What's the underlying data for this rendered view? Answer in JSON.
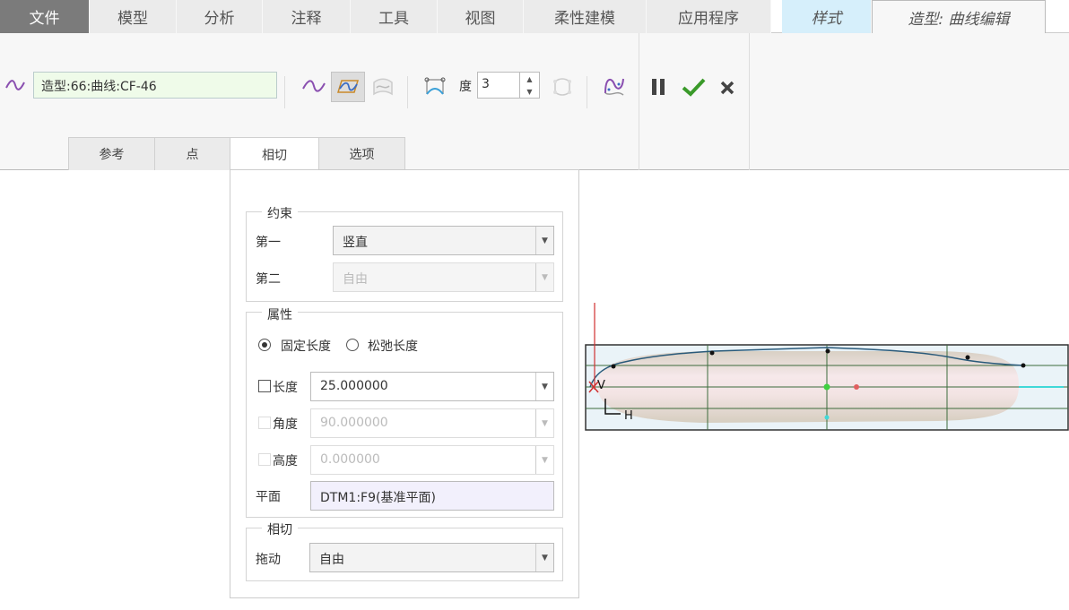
{
  "tabs": [
    {
      "label": "文件"
    },
    {
      "label": "模型"
    },
    {
      "label": "分析"
    },
    {
      "label": "注释"
    },
    {
      "label": "工具"
    },
    {
      "label": "视图"
    },
    {
      "label": "柔性建模"
    },
    {
      "label": "应用程序"
    },
    {
      "label": "样式"
    },
    {
      "label": "造型: 曲线编辑"
    }
  ],
  "ribbon": {
    "curve_reference": "造型:66:曲线:CF-46",
    "degree_label": "度",
    "degree_value": "3"
  },
  "subtabs": [
    {
      "label": "参考"
    },
    {
      "label": "点"
    },
    {
      "label": "相切"
    },
    {
      "label": "选项"
    }
  ],
  "panel": {
    "constraint": {
      "title": "约束",
      "first_label": "第一",
      "first_value": "竖直",
      "second_label": "第二",
      "second_value": "自由"
    },
    "properties": {
      "title": "属性",
      "radio_fixed": "固定长度",
      "radio_relaxed": "松弛长度",
      "length_label": "长度",
      "length_value": "25.000000",
      "angle_label": "角度",
      "angle_value": "90.000000",
      "height_label": "高度",
      "height_value": "0.000000",
      "plane_label": "平面",
      "plane_value": "DTM1:F9(基准平面)"
    },
    "tangent": {
      "title": "相切",
      "drag_label": "拖动",
      "drag_value": "自由"
    }
  },
  "viewport": {
    "axis_v": "V",
    "axis_h": "H"
  },
  "colors": {
    "file_tab": "#7b7b7b",
    "style_tab": "#d6effb",
    "curve_input": "#effbe9",
    "check": "#3a9a2a"
  }
}
